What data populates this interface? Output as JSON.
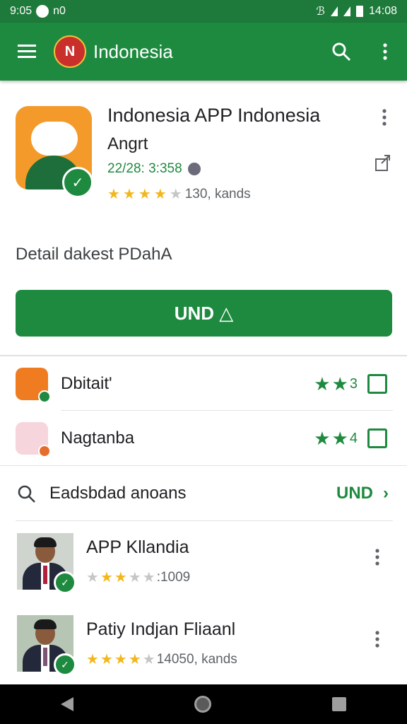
{
  "status_bar": {
    "left_text": "9:05",
    "left_extra": "n0",
    "time": "14:08"
  },
  "app_bar": {
    "logo_text": "N",
    "title": "Indonesia"
  },
  "app": {
    "name": "Indonesia APP Indonesia",
    "developer": "Angrt",
    "meta": "22/28: 3:358",
    "rating_text": "130, kands",
    "stars": 4,
    "detail": "Detail  dakest PDahA",
    "install_label": "UND △"
  },
  "related": [
    {
      "label": "Dbitait'",
      "score": "3",
      "stars": 2,
      "icon_color": "#f07c22",
      "badge_color": "#1e8a3f"
    },
    {
      "label": "Nagtanba",
      "score": "4",
      "stars": 2,
      "icon_color": "#f6d5dc",
      "badge_color": "#e66c2c"
    }
  ],
  "section": {
    "title": "Eadsbdad anoans",
    "more_label": "UND"
  },
  "list": [
    {
      "title": "APP Kllandia",
      "rating_text": ":1009",
      "stars": 3
    },
    {
      "title": "Patiy Indjan Fliaanl",
      "rating_text": "14050, kands",
      "stars": 4
    }
  ],
  "colors": {
    "primary": "#1e8a3f",
    "status_bar": "#1e7a3a",
    "star": "#f2b71d"
  }
}
